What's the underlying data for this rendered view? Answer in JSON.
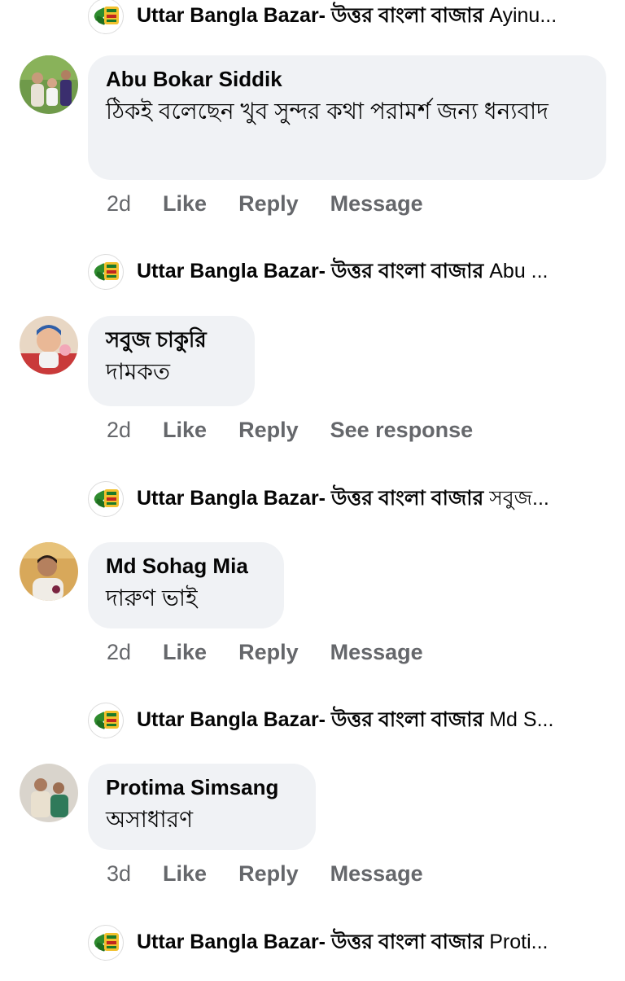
{
  "page_name": "Uttar Bangla Bazar- উত্তর বাংলা বাজার",
  "replies": [
    {
      "snippet": "Ayinu..."
    },
    {
      "snippet": "Abu ..."
    },
    {
      "snippet": "সবুজ..."
    },
    {
      "snippet": "Md S..."
    },
    {
      "snippet": "Proti..."
    }
  ],
  "comments": [
    {
      "author": "Abu Bokar Siddik",
      "text": "ঠিকই বলেছেন খুব সুন্দর কথা পরামর্শ জন্য ধন্যবাদ",
      "time": "2d",
      "like": "Like",
      "reply": "Reply",
      "extra": "Message"
    },
    {
      "author": "সবুজ চাকুরি",
      "text": "দামকত",
      "time": "2d",
      "like": "Like",
      "reply": "Reply",
      "extra": "See response"
    },
    {
      "author": "Md Sohag Mia",
      "text": "দারুণ ভাই",
      "time": "2d",
      "like": "Like",
      "reply": "Reply",
      "extra": "Message"
    },
    {
      "author": "Protima Simsang",
      "text": "অসাধারণ",
      "time": "3d",
      "like": "Like",
      "reply": "Reply",
      "extra": "Message"
    }
  ]
}
